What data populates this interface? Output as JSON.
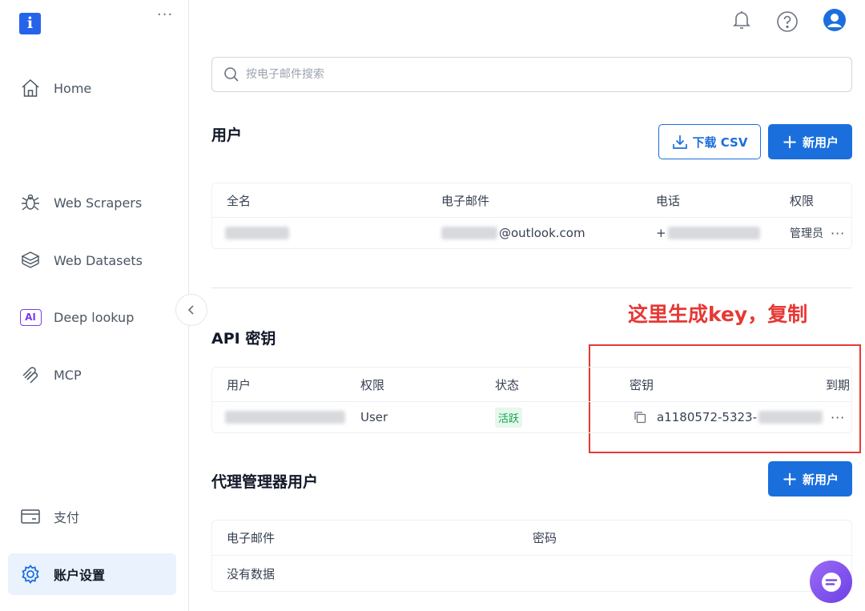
{
  "app": {
    "logo_letter": "i"
  },
  "sidebar": {
    "more_label": "···",
    "items": [
      {
        "label": "Home",
        "icon": "home-icon"
      },
      {
        "label": "Web Scrapers",
        "icon": "bug-icon"
      },
      {
        "label": "Web Datasets",
        "icon": "layers-icon"
      },
      {
        "label": "Deep lookup",
        "icon": "ai-icon",
        "icon_text": "AI"
      },
      {
        "label": "MCP",
        "icon": "mcp-icon"
      },
      {
        "label": "支付",
        "icon": "card-icon"
      },
      {
        "label": "账户设置",
        "icon": "gear-icon"
      }
    ]
  },
  "topbar": {
    "icons": [
      "bell-icon",
      "help-icon",
      "user-avatar-icon"
    ]
  },
  "search": {
    "placeholder": "按电子邮件搜索",
    "value": ""
  },
  "users": {
    "title": "用户",
    "download_label": "下载 CSV",
    "new_label": "新用户",
    "columns": [
      "全名",
      "电子邮件",
      "电话",
      "权限"
    ],
    "rows": [
      {
        "name": "",
        "email_suffix": "@outlook.com",
        "phone_prefix": "+",
        "role": "管理员"
      }
    ]
  },
  "api_keys": {
    "title": "API 密钥",
    "columns": [
      "用户",
      "权限",
      "状态",
      "密钥",
      "到期"
    ],
    "rows": [
      {
        "user": "",
        "role": "User",
        "status": "活跃",
        "key": "a1180572-5323-"
      }
    ]
  },
  "annotation": {
    "text": "这里生成key，复制",
    "color": "#e53935"
  },
  "proxy": {
    "title": "代理管理器用户",
    "new_label": "新用户",
    "columns": [
      "电子邮件",
      "密码"
    ],
    "empty_text": "没有数据"
  },
  "colors": {
    "primary": "#1a6fdd",
    "active_bg": "#eaf2fd",
    "success": "#16a34a"
  }
}
